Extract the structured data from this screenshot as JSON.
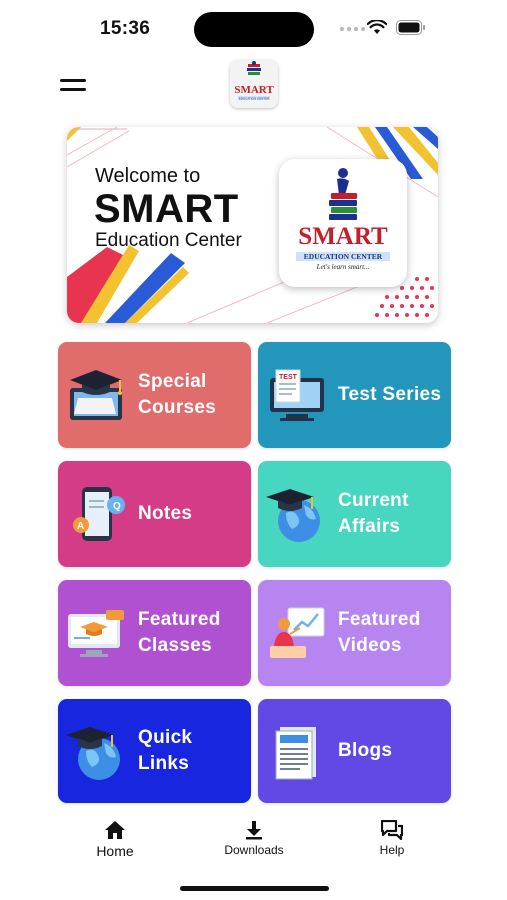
{
  "status_bar": {
    "time": "15:36"
  },
  "header": {
    "logo_text": "SMART",
    "logo_subtext": "EDUCATION CENTER"
  },
  "banner": {
    "welcome": "Welcome to",
    "title": "SMART",
    "subtitle": "Education Center",
    "logo_title": "SMART",
    "logo_subtitle": "EDUCATION CENTER",
    "logo_tagline": "Let's learn smart..."
  },
  "menu": [
    {
      "label_line1": "Special",
      "label_line2": "Courses",
      "color": "#e06c6c",
      "icon": "graduation-laptop-icon"
    },
    {
      "label_line1": "Test Series",
      "label_line2": "",
      "color": "#2397bb",
      "icon": "test-monitor-icon"
    },
    {
      "label_line1": "Notes",
      "label_line2": "",
      "color": "#d53c87",
      "icon": "phone-notes-icon"
    },
    {
      "label_line1": "Current",
      "label_line2": "Affairs",
      "color": "#47d6c0",
      "icon": "globe-cap-icon"
    },
    {
      "label_line1": "Featured",
      "label_line2": "Classes",
      "color": "#b051d1",
      "icon": "online-class-icon"
    },
    {
      "label_line1": "Featured",
      "label_line2": "Videos",
      "color": "#b785f0",
      "icon": "presentation-icon"
    },
    {
      "label_line1": "Quick",
      "label_line2": "Links",
      "color": "#1826e0",
      "icon": "globe-cap-icon"
    },
    {
      "label_line1": "Blogs",
      "label_line2": "",
      "color": "#6248e4",
      "icon": "newspaper-icon"
    }
  ],
  "bottom_nav": {
    "home": "Home",
    "downloads": "Downloads",
    "help": "Help"
  }
}
